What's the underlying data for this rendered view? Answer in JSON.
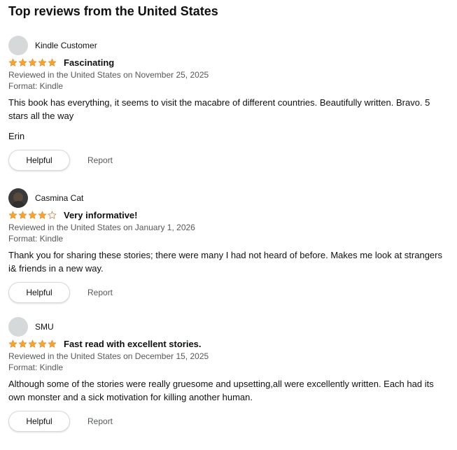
{
  "heading": "Top reviews from the United States",
  "colors": {
    "star": "#ffa41c",
    "star_empty": "#d5d9d9"
  },
  "reviews": [
    {
      "author": "Kindle Customer",
      "avatar": "default",
      "rating": 5,
      "title": "Fascinating",
      "reviewed": "Reviewed in the United States on November 25, 2025",
      "format": "Format: Kindle",
      "body": "This book has everything, it seems to visit the macabre of different countries. Beautifully written. Bravo. 5 stars all the way",
      "signature": "Erin",
      "helpful_label": "Helpful",
      "report_label": "Report"
    },
    {
      "author": "Casmina Cat",
      "avatar": "photo",
      "rating": 4,
      "title": "Very informative!",
      "reviewed": "Reviewed in the United States on January 1, 2026",
      "format": "Format: Kindle",
      "body": "Thank you for sharing these stories; there were many I had not heard of before. Makes me look at strangers i& friends in a new way.",
      "signature": "",
      "helpful_label": "Helpful",
      "report_label": "Report"
    },
    {
      "author": "SMU",
      "avatar": "default",
      "rating": 5,
      "title": "Fast read with excellent stories.",
      "reviewed": "Reviewed in the United States on December 15, 2025",
      "format": "Format: Kindle",
      "body": "Although some of the stories were really gruesome and upsetting,all were excellently written. Each had its own monster and a sick motivation for killing another human.",
      "signature": "",
      "helpful_label": "Helpful",
      "report_label": "Report"
    }
  ]
}
